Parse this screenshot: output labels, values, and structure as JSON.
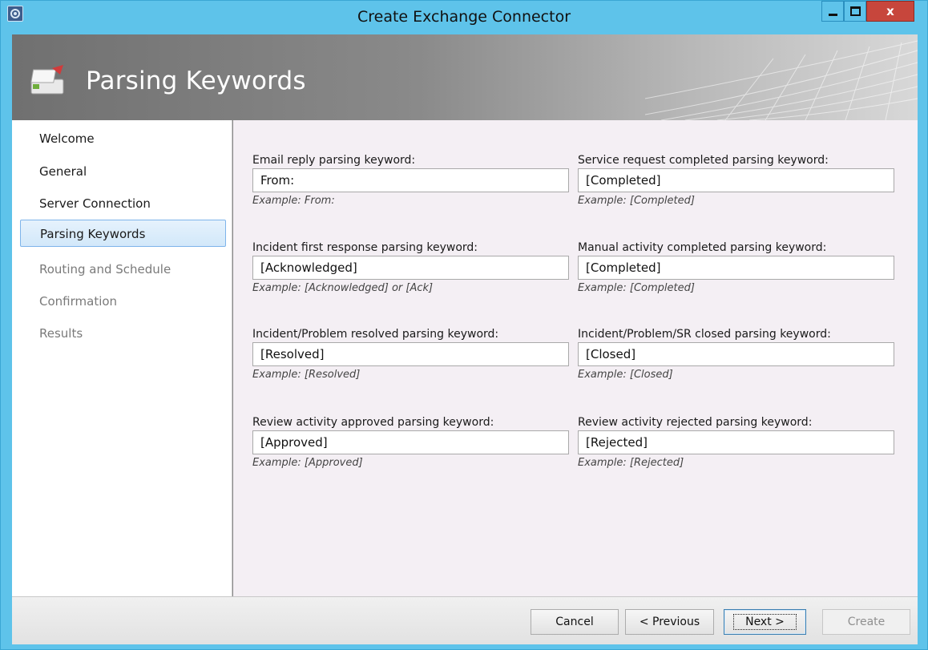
{
  "window": {
    "title": "Create Exchange Connector",
    "buttons": {
      "minimize": "minimize",
      "maximize": "maximize",
      "close": "x"
    }
  },
  "banner": {
    "title": "Parsing Keywords"
  },
  "sidebar": {
    "items": [
      {
        "label": "Welcome",
        "state": "normal"
      },
      {
        "label": "General",
        "state": "normal"
      },
      {
        "label": "Server Connection",
        "state": "normal"
      },
      {
        "label": "Parsing Keywords",
        "state": "selected"
      },
      {
        "label": "Routing and Schedule",
        "state": "disabled"
      },
      {
        "label": "Confirmation",
        "state": "disabled"
      },
      {
        "label": "Results",
        "state": "disabled"
      }
    ]
  },
  "fields": [
    {
      "label": "Email reply parsing keyword:",
      "value": "From:",
      "example": "Example: From:"
    },
    {
      "label": "Service request completed parsing keyword:",
      "value": "[Completed]",
      "example": "Example: [Completed]"
    },
    {
      "label": "Incident first response parsing keyword:",
      "value": "[Acknowledged]",
      "example": "Example: [Acknowledged] or [Ack]"
    },
    {
      "label": "Manual activity completed parsing keyword:",
      "value": "[Completed]",
      "example": "Example: [Completed]"
    },
    {
      "label": "Incident/Problem resolved parsing keyword:",
      "value": "[Resolved]",
      "example": "Example: [Resolved]"
    },
    {
      "label": "Incident/Problem/SR closed parsing keyword:",
      "value": "[Closed]",
      "example": "Example: [Closed]"
    },
    {
      "label": "Review activity approved parsing keyword:",
      "value": "[Approved]",
      "example": "Example: [Approved]"
    },
    {
      "label": "Review activity rejected parsing keyword:",
      "value": "[Rejected]",
      "example": "Example: [Rejected]"
    }
  ],
  "footer": {
    "cancel_label": "Cancel",
    "previous_label": "< Previous",
    "next_label": "Next >",
    "create_label": "Create"
  },
  "colors": {
    "titlebar": "#5ec3ea",
    "close_button": "#c7463c",
    "content_bg": "#f4eff4",
    "selected_item": "#d2e8fa"
  }
}
